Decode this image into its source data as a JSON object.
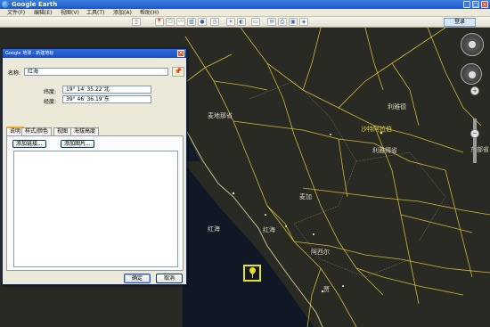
{
  "window": {
    "title": "Google Earth",
    "buttons": [
      "_",
      "□",
      "×"
    ]
  },
  "menu": [
    "文件(F)",
    "编辑(E)",
    "视图(V)",
    "工具(T)",
    "添加(A)",
    "帮助(H)"
  ],
  "toolbar": {
    "login_label": "登录"
  },
  "map_labels": {
    "red_sea_north": "红海",
    "red_sea_south": "红海",
    "makkah_region": "麦加",
    "asir_region": "阿西尔",
    "riyadh_region": "利雅德",
    "riyadh_province": "利雅得省",
    "saudi_arabia": "沙特阿拉伯",
    "east_province": "东部省",
    "medina": "麦地那省",
    "jizan": "贾"
  },
  "dialog": {
    "title": "Google 地球 - 新建地标",
    "name_label": "名称:",
    "name_value": "红海",
    "latitude_label": "纬度:",
    "latitude_value": "19° 14′ 35.22″北",
    "longitude_label": "经度:",
    "longitude_value": "39° 46′ 36.19″东",
    "tabs": [
      "说明",
      "样式/颜色",
      "视图",
      "海拔高度"
    ],
    "active_tab": "说明",
    "add_link_label": "添加链接...",
    "add_image_label": "添加图片...",
    "ok_label": "确定",
    "cancel_label": "取消"
  }
}
